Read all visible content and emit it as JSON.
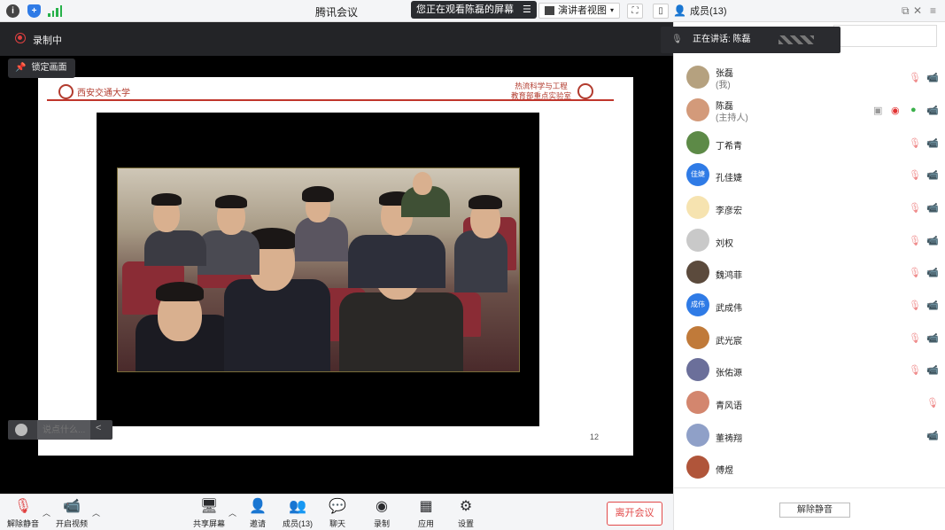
{
  "titlebar": {
    "app_title": "腾讯会议",
    "viewing_notice": "您正在观看陈磊的屏幕",
    "view_mode": "演讲者视图",
    "members_label": "成员(13)"
  },
  "recording": {
    "label": "录制中"
  },
  "lock_view": {
    "label": "锁定画面"
  },
  "slide": {
    "university": "西安交通大学",
    "lab_line1": "热流科学与工程",
    "lab_line2": "教育部重点实验室",
    "page_number": "12"
  },
  "chat": {
    "placeholder": "说点什么..."
  },
  "toolbar": {
    "unmute_label": "解除静音",
    "video_label": "开启视频",
    "share_label": "共享屏幕",
    "invite_label": "邀请",
    "members_label": "成员(13)",
    "chat_label": "聊天",
    "record_label": "录制",
    "apps_label": "应用",
    "settings_label": "设置",
    "leave_label": "离开会议"
  },
  "panel": {
    "speaking_label": "正在讲话: 陈磊",
    "members": [
      {
        "name": "张磊",
        "role": "(我)"
      },
      {
        "name": "陈磊",
        "role": "(主持人)"
      },
      {
        "name": "丁希青",
        "role": ""
      },
      {
        "name": "孔佳婕",
        "role": "",
        "avatar_text": "佳婕"
      },
      {
        "name": "李彦宏",
        "role": ""
      },
      {
        "name": "刘权",
        "role": ""
      },
      {
        "name": "魏鸿菲",
        "role": ""
      },
      {
        "name": "武成伟",
        "role": "",
        "avatar_text": "成伟"
      },
      {
        "name": "武光宸",
        "role": ""
      },
      {
        "name": "张佑源",
        "role": ""
      },
      {
        "name": "青风语",
        "role": ""
      },
      {
        "name": "董祷翔",
        "role": ""
      },
      {
        "name": "傅煜",
        "role": ""
      }
    ],
    "unmute_all_label": "解除静音"
  },
  "colors": {
    "accent": "#2f7be6",
    "record_red": "#e04040",
    "muted_red": "#ef8b8b",
    "leave_red": "#e24a4a",
    "mic_green": "#3ab04a"
  }
}
